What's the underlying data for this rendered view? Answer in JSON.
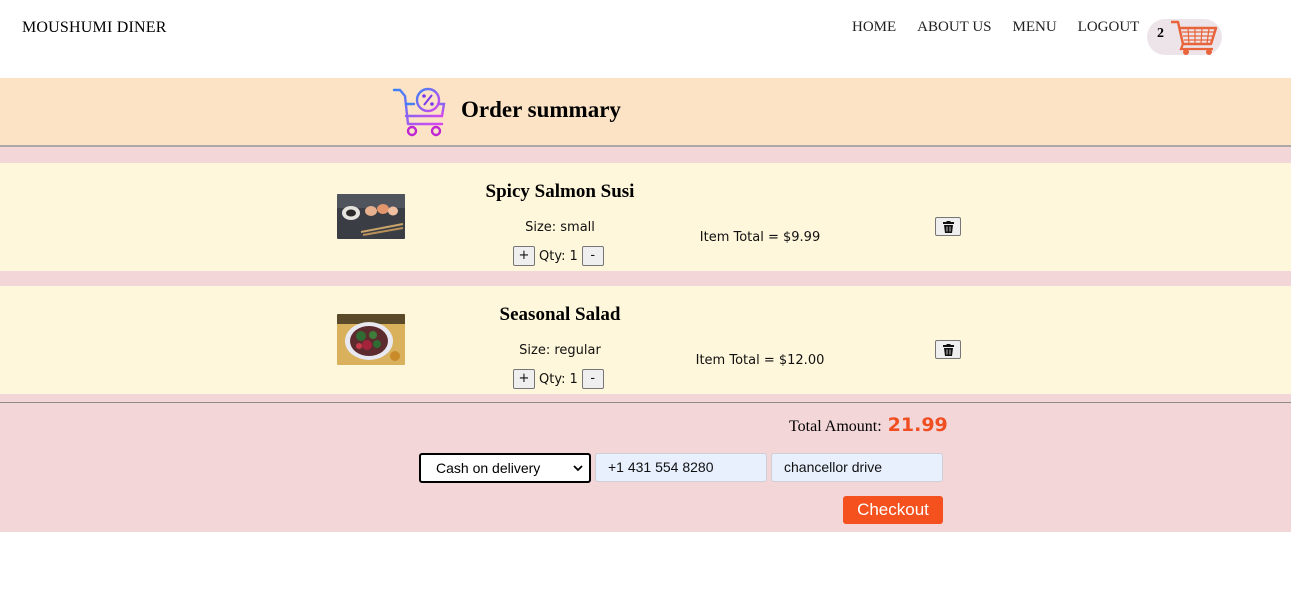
{
  "header": {
    "brand": "MOUSHUMI DINER",
    "nav": [
      "HOME",
      "ABOUT US",
      "MENU",
      "LOGOUT"
    ],
    "cart_count": "2"
  },
  "summary": {
    "title": "Order summary"
  },
  "items": [
    {
      "name": "Spicy Salmon Susi",
      "size": "Size: small",
      "qty_label": "Qty:",
      "qty": "1",
      "plus": "+",
      "minus": "-",
      "total": "Item Total = $9.99"
    },
    {
      "name": "Seasonal Salad",
      "size": "Size: regular",
      "qty_label": "Qty:",
      "qty": "1",
      "plus": "+",
      "minus": "-",
      "total": "Item Total = $12.00"
    }
  ],
  "totals": {
    "label": "Total Amount:",
    "value": "21.99"
  },
  "form": {
    "payment_method": "Cash on delivery",
    "phone": "+1 431 554 8280",
    "address": "chancellor drive",
    "checkout_label": "Checkout"
  },
  "colors": {
    "accent": "#f4511e",
    "banner": "#fde3c5",
    "item_bg": "#fef7db",
    "pink": "#f2d6d8"
  },
  "icons": [
    "cart-icon",
    "shopping-cart-discount-icon",
    "trash-icon",
    "chevron-down-icon"
  ]
}
